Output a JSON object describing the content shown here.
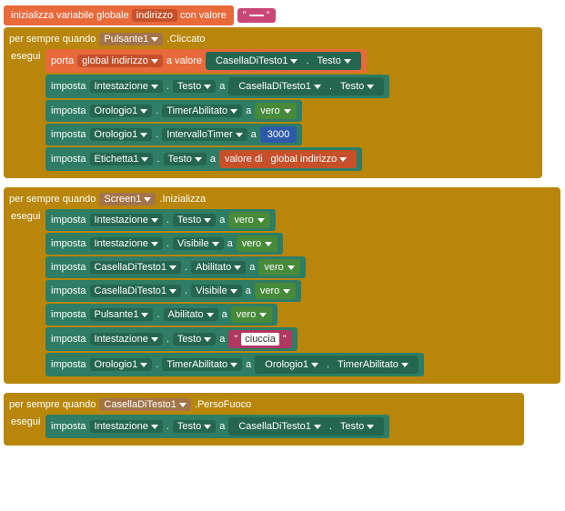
{
  "init": {
    "label": "inizializza variabile globale",
    "var_name": "indirizzo",
    "con": "con valore",
    "text_open": "\"",
    "text_value": " ",
    "text_close": "\""
  },
  "block1": {
    "header": {
      "when": "per sempre quando",
      "comp": "Pulsante1",
      "event": ".Cliccato"
    },
    "do": "esegui",
    "rows": [
      {
        "type": "set",
        "label": "porta",
        "var": "global indirizzo",
        "to": "a valore",
        "src_comp": "CasellaDiTesto1",
        "dot": ".",
        "src_prop": "Testo"
      },
      {
        "type": "setprop",
        "label": "imposta",
        "comp": "Intestazione",
        "dot": ".",
        "prop": "Testo",
        "to": "a",
        "src_comp": "CasellaDiTesto1",
        "src_prop": "Testo"
      },
      {
        "type": "setprop",
        "label": "imposta",
        "comp": "Orologio1",
        "dot": ".",
        "prop": "TimerAbilitato",
        "to": "a",
        "val": "vero"
      },
      {
        "type": "setprop",
        "label": "imposta",
        "comp": "Orologio1",
        "dot": ".",
        "prop": "IntervalloTimer",
        "to": "a",
        "val": "3000"
      },
      {
        "type": "setprop",
        "label": "imposta",
        "comp": "Etichetta1",
        "dot": ".",
        "prop": "Testo",
        "to": "a",
        "val_label": "valore di",
        "val_var": "global indirizzo"
      }
    ]
  },
  "block2": {
    "header": {
      "when": "per sempre quando",
      "comp": "Screen1",
      "event": ".Inizializza"
    },
    "do": "esegui",
    "rows": [
      {
        "label": "imposta",
        "comp": "Intestazione",
        "prop": "Testo",
        "to": "a",
        "val": "vero"
      },
      {
        "label": "imposta",
        "comp": "Intestazione",
        "prop": "Visibile",
        "to": "a",
        "val": "vero"
      },
      {
        "label": "imposta",
        "comp": "CasellaDiTesto1",
        "prop": "Abilitato",
        "to": "a",
        "val": "vero"
      },
      {
        "label": "imposta",
        "comp": "CasellaDiTesto1",
        "prop": "Visibile",
        "to": "a",
        "val": "vero"
      },
      {
        "label": "imposta",
        "comp": "Pulsante1",
        "prop": "Abilitato",
        "to": "a",
        "val": "vero"
      },
      {
        "label": "imposta",
        "comp": "Intestazione",
        "prop": "Testo",
        "to": "a",
        "text": "ciuccia"
      },
      {
        "label": "imposta",
        "comp": "Orologio1",
        "prop": "TimerAbilitato",
        "to": "a",
        "src_comp": "Orologio1",
        "src_prop": "TimerAbilitato"
      }
    ]
  },
  "block3": {
    "header": {
      "when": "per sempre quando",
      "comp": "CasellaDiTesto1",
      "event": ".PersoFuoco"
    },
    "do": "esegui",
    "rows": [
      {
        "label": "imposta",
        "comp": "Intestazione",
        "prop": "Testo",
        "to": "a",
        "src_comp": "CasellaDiTesto1",
        "src_prop": "Testo"
      }
    ]
  },
  "dot": "."
}
